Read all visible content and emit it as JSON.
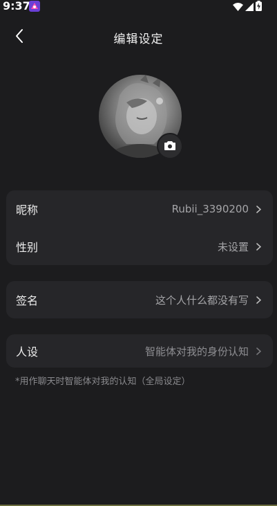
{
  "status_bar": {
    "time": "9:37"
  },
  "header": {
    "title": "编辑设定"
  },
  "profile": {
    "name_label": "昵称",
    "name_value": "Rubii_3390200",
    "gender_label": "性别",
    "gender_value": "未设置",
    "signature_label": "签名",
    "signature_value": "这个人什么都没有写",
    "persona_label": "人设",
    "persona_placeholder": "智能体对我的身份认知"
  },
  "footnote": "*用作聊天时智能体对我的认知（全局设定）",
  "colors": {
    "background": "#1c1c1e",
    "card": "#262629",
    "text_primary": "#ececec",
    "text_secondary": "#a5a5a8"
  }
}
